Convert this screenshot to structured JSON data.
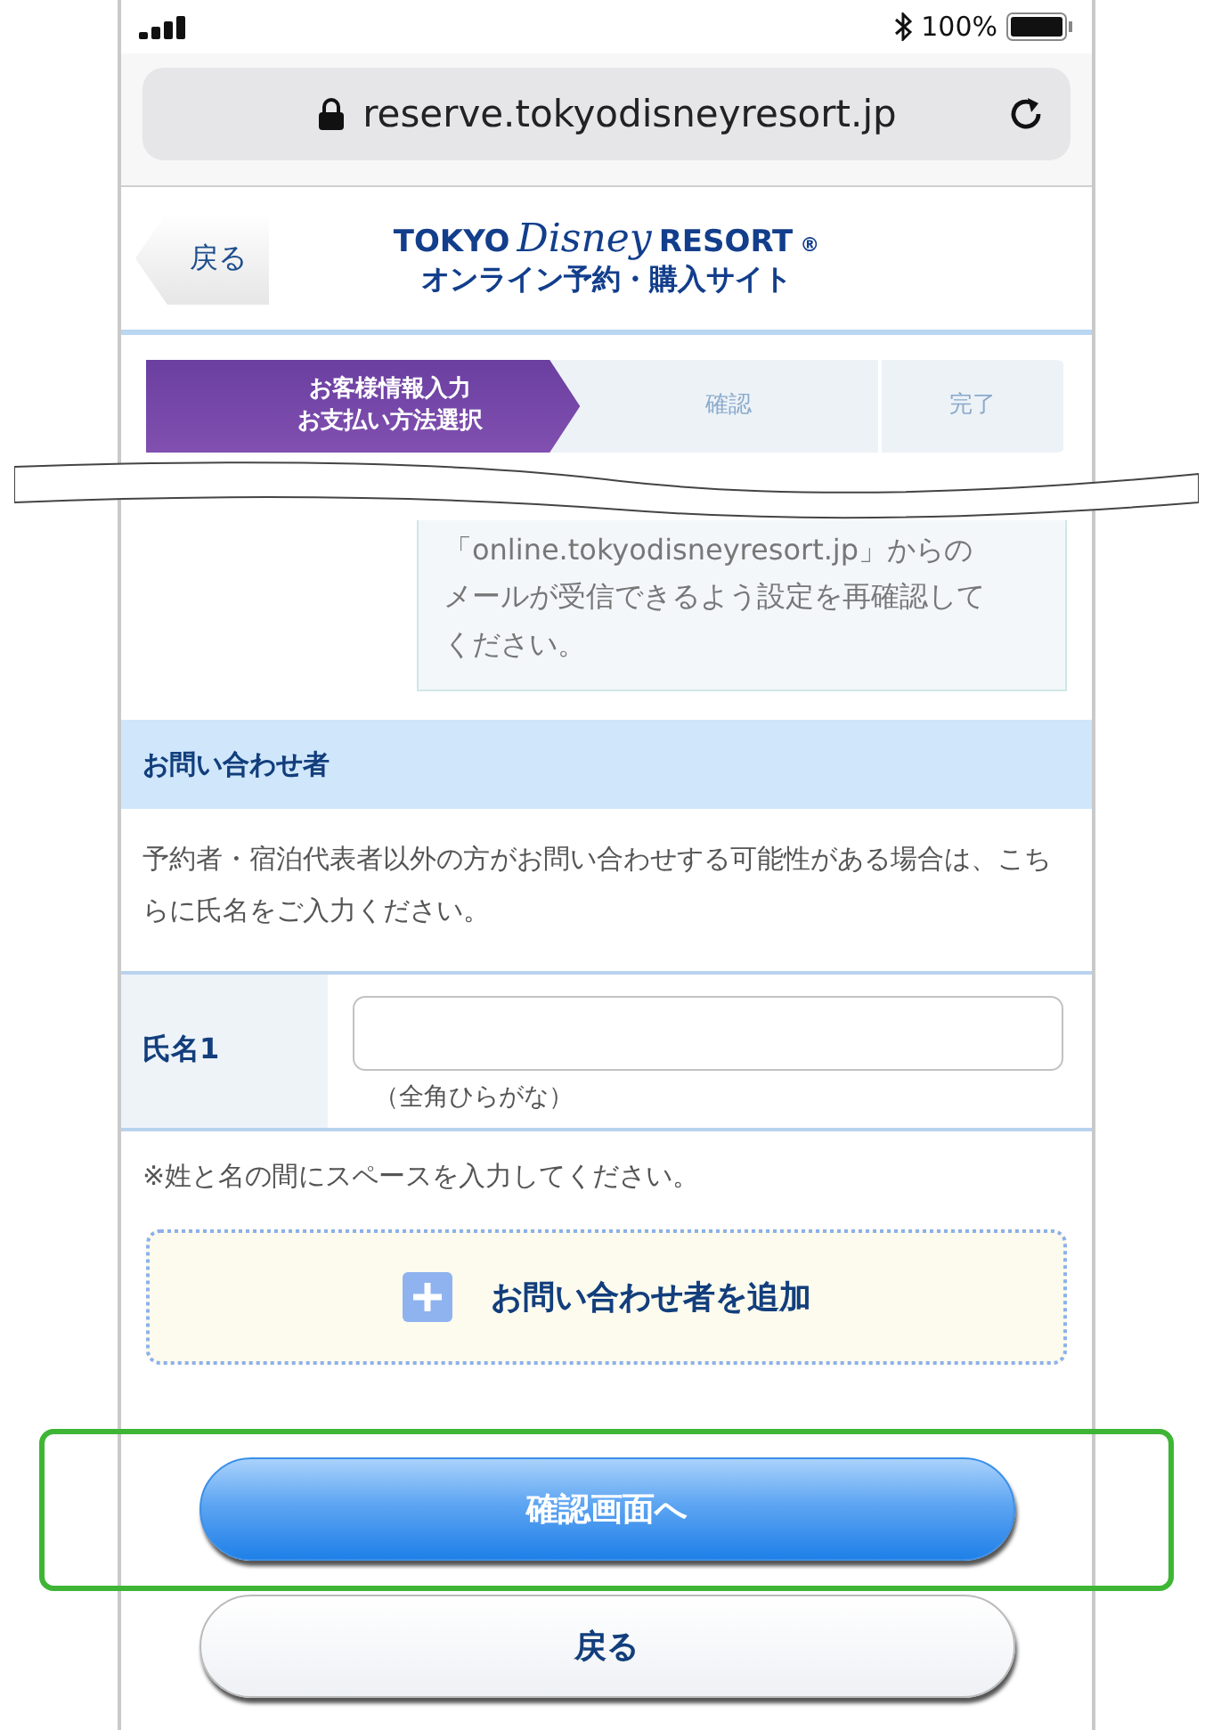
{
  "status_bar": {
    "battery_text": "100%"
  },
  "address_bar": {
    "url": "reserve.tokyodisneyresort.jp"
  },
  "header": {
    "back_label": "戻る",
    "logo": {
      "left": "TOKYO",
      "script": "Disney",
      "right": "RESORT",
      "mark": "®"
    },
    "subtitle": "オンライン予約・購入サイト"
  },
  "steps": [
    {
      "lines": [
        "お客様情報入力",
        "お支払い方法選択"
      ],
      "selected": true
    },
    {
      "lines": [
        "確認"
      ],
      "selected": false
    },
    {
      "lines": [
        "完了"
      ],
      "selected": false
    }
  ],
  "mail_note": {
    "lines": [
      "「online.tokyodisneyresort.jp」からの",
      "メールが受信できるよう設定を再確認して",
      "ください。"
    ]
  },
  "contact_section": {
    "title": "お問い合わせ者",
    "description": "予約者・宿泊代表者以外の方がお問い合わせする可能性がある場合は、こちらに氏名をご入力ください。",
    "fields": [
      {
        "label": "氏名1",
        "hint": "（全角ひらがな）"
      }
    ],
    "note": "※姓と名の間にスペースを入力してください。",
    "add_label": "お問い合わせ者を追加"
  },
  "buttons": [
    {
      "label": "確認画面へ",
      "kind": "primary",
      "highlighted": true
    },
    {
      "label": "戻る",
      "kind": "secondary",
      "highlighted": false
    }
  ]
}
